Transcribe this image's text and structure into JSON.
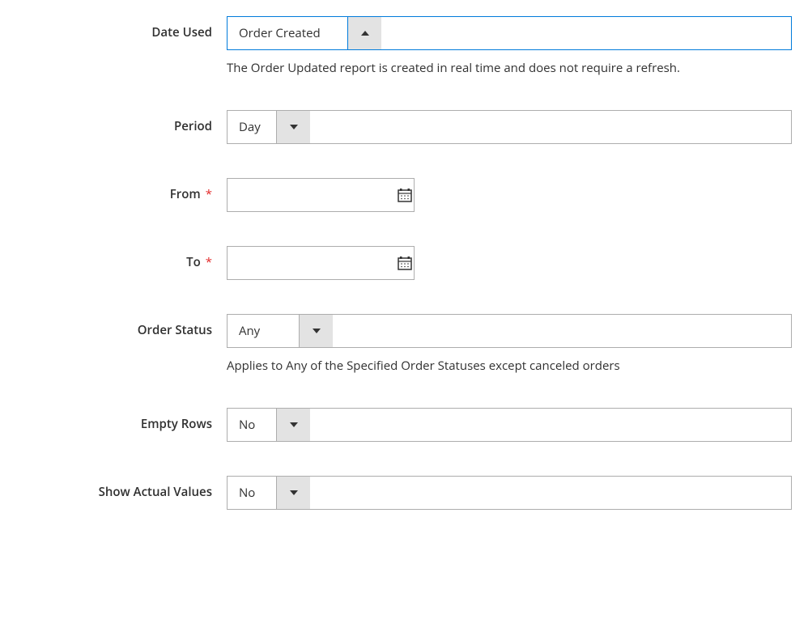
{
  "form": {
    "date_used": {
      "label": "Date Used",
      "value": "Order Created",
      "help": "The Order Updated report is created in real time and does not require a refresh."
    },
    "period": {
      "label": "Period",
      "value": "Day"
    },
    "from": {
      "label": "From",
      "value": "",
      "required": "*"
    },
    "to": {
      "label": "To",
      "value": "",
      "required": "*"
    },
    "order_status": {
      "label": "Order Status",
      "value": "Any",
      "help": "Applies to Any of the Specified Order Statuses except canceled orders"
    },
    "empty_rows": {
      "label": "Empty Rows",
      "value": "No"
    },
    "show_actual_values": {
      "label": "Show Actual Values",
      "value": "No"
    }
  }
}
